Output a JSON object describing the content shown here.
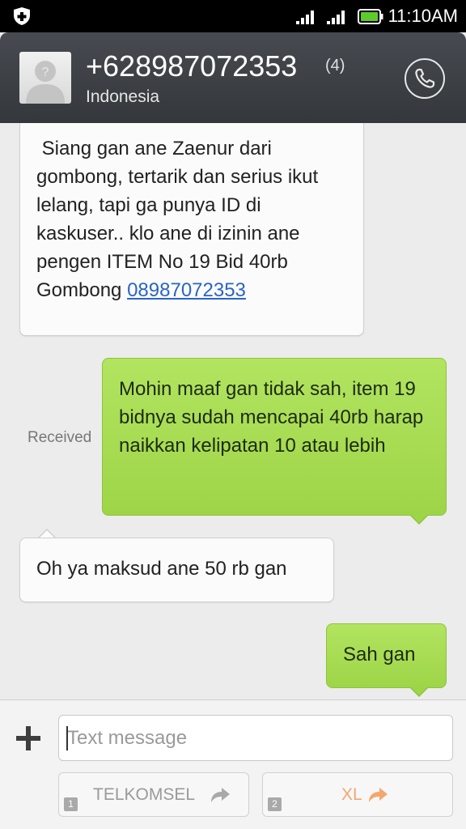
{
  "status_bar": {
    "time": "11:10AM",
    "left_icon": "shield-plus-icon",
    "icons": [
      "signal-icon",
      "signal-icon",
      "battery-icon"
    ]
  },
  "header": {
    "number": "+628987072353",
    "count": "(4)",
    "region": "Indonesia",
    "avatar_icon": "unknown-contact-avatar-icon",
    "call_icon": "phone-icon"
  },
  "messages": [
    {
      "direction": "incoming",
      "text": " Siang gan ane Zaenur dari gombong, tertarik dan serius ikut lelang, tapi ga punya ID di kaskuser.. klo ane di izinin ane pengen ITEM No 19 Bid 40rb Gombong ",
      "link": "08987072353"
    },
    {
      "direction": "outgoing",
      "text": "Mohin maaf gan tidak sah, item 19 bidnya sudah mencapai 40rb harap naikkan kelipatan 10 atau lebih",
      "status": "Received"
    },
    {
      "direction": "incoming",
      "text": "Oh ya maksud ane 50 rb gan"
    },
    {
      "direction": "outgoing",
      "text": "Sah gan"
    }
  ],
  "composer": {
    "add_icon": "plus-icon",
    "placeholder": "Text message",
    "value": "",
    "sim_buttons": [
      {
        "index": "1",
        "label": "TELKOMSEL",
        "icon": "send-arrow-icon",
        "color": "#9a9a9a"
      },
      {
        "index": "2",
        "label": "XL",
        "icon": "send-arrow-icon",
        "color": "#f3a770"
      }
    ]
  },
  "colors": {
    "header": "#3d4045",
    "incoming_bubble": "#fbfbfb",
    "outgoing_bubble": "#a8dc52",
    "link": "#2a64c8",
    "background": "#ececec"
  }
}
